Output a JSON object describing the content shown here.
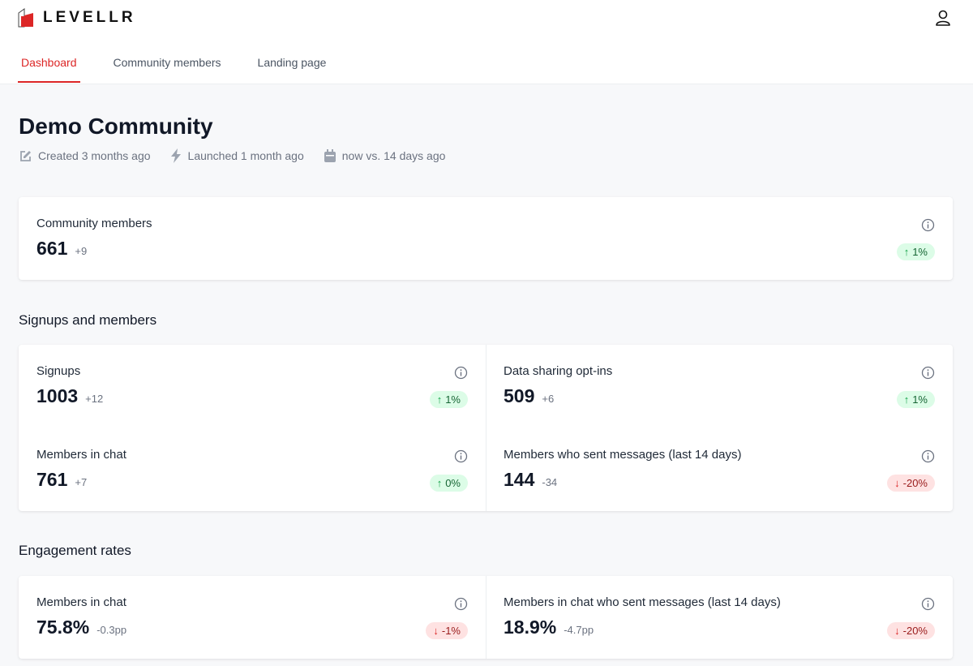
{
  "brand": {
    "name": "LEVELLR"
  },
  "nav": {
    "tabs": [
      {
        "label": "Dashboard",
        "active": true
      },
      {
        "label": "Community members"
      },
      {
        "label": "Landing page"
      }
    ]
  },
  "page": {
    "title": "Demo Community",
    "meta": [
      {
        "icon": "pencil-square-icon",
        "text": "Created 3 months ago"
      },
      {
        "icon": "lightning-icon",
        "text": "Launched 1 month ago"
      },
      {
        "icon": "calendar-icon",
        "text": "now vs. 14 days ago"
      }
    ]
  },
  "summary": {
    "label": "Community members",
    "value": "661",
    "delta": "+9",
    "change": "1%",
    "direction": "up"
  },
  "sections": [
    {
      "title": "Signups and members",
      "stats": [
        {
          "label": "Signups",
          "value": "1003",
          "delta": "+12",
          "change": "1%",
          "direction": "up"
        },
        {
          "label": "Data sharing opt-ins",
          "value": "509",
          "delta": "+6",
          "change": "1%",
          "direction": "up"
        },
        {
          "label": "Members in chat",
          "value": "761",
          "delta": "+7",
          "change": "0%",
          "direction": "up"
        },
        {
          "label": "Members who sent messages (last 14 days)",
          "value": "144",
          "delta": "-34",
          "change": "-20%",
          "direction": "down"
        }
      ]
    },
    {
      "title": "Engagement rates",
      "stats": [
        {
          "label": "Members in chat",
          "value": "75.8%",
          "delta": "-0.3pp",
          "change": "-1%",
          "direction": "down"
        },
        {
          "label": "Members in chat who sent messages (last 14 days)",
          "value": "18.9%",
          "delta": "-4.7pp",
          "change": "-20%",
          "direction": "down"
        }
      ]
    }
  ],
  "colors": {
    "accent": "#dc2626",
    "up": "#16a34a",
    "down": "#dc2626"
  }
}
